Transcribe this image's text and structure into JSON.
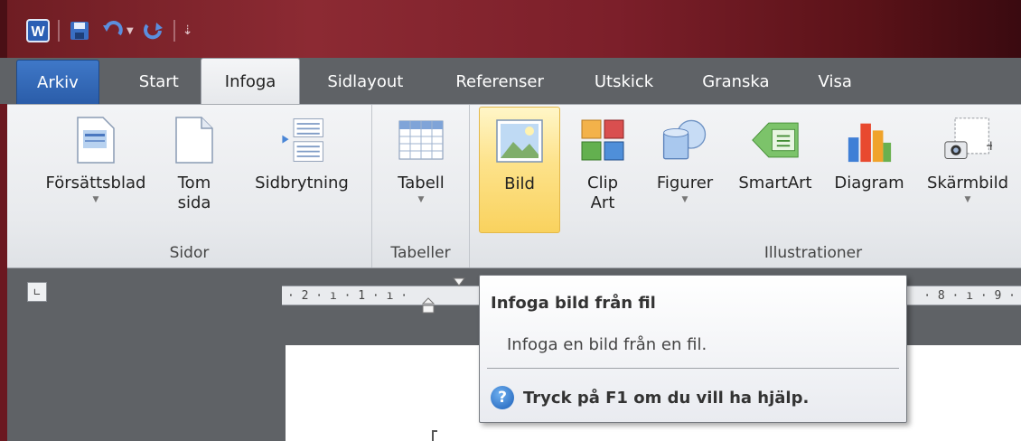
{
  "colors": {
    "title_bar": "#7c1f2a",
    "file_tab": "#2a5ca8",
    "hover_button": "#fde28a"
  },
  "tabs": [
    {
      "label": "Arkiv"
    },
    {
      "label": "Start"
    },
    {
      "label": "Infoga"
    },
    {
      "label": "Sidlayout"
    },
    {
      "label": "Referenser"
    },
    {
      "label": "Utskick"
    },
    {
      "label": "Granska"
    },
    {
      "label": "Visa"
    }
  ],
  "active_tab": "Infoga",
  "groups": {
    "sidor": {
      "label": "Sidor",
      "buttons": [
        {
          "label": "Försättsblad",
          "icon": "cover-page-icon"
        },
        {
          "label": "Tom sida",
          "icon": "blank-page-icon"
        },
        {
          "label": "Sidbrytning",
          "icon": "page-break-icon"
        }
      ]
    },
    "tabeller": {
      "label": "Tabeller",
      "buttons": [
        {
          "label": "Tabell",
          "icon": "table-icon"
        }
      ]
    },
    "illustrationer": {
      "label": "Illustrationer",
      "buttons": [
        {
          "label": "Bild",
          "icon": "picture-icon"
        },
        {
          "label": "Clip Art",
          "icon": "clip-art-icon"
        },
        {
          "label": "Figurer",
          "icon": "shapes-icon"
        },
        {
          "label": "SmartArt",
          "icon": "smartart-icon"
        },
        {
          "label": "Diagram",
          "icon": "chart-icon"
        },
        {
          "label": "Skärmbild",
          "icon": "screenshot-icon"
        }
      ]
    }
  },
  "ruler": {
    "left": "· 2 · ı · 1 · ı ·",
    "right": "· 8 · ı · 9 ·"
  },
  "tooltip": {
    "title": "Infoga bild från fil",
    "body": "Infoga en bild från en fil.",
    "help": "Tryck på F1 om du vill ha hjälp."
  }
}
